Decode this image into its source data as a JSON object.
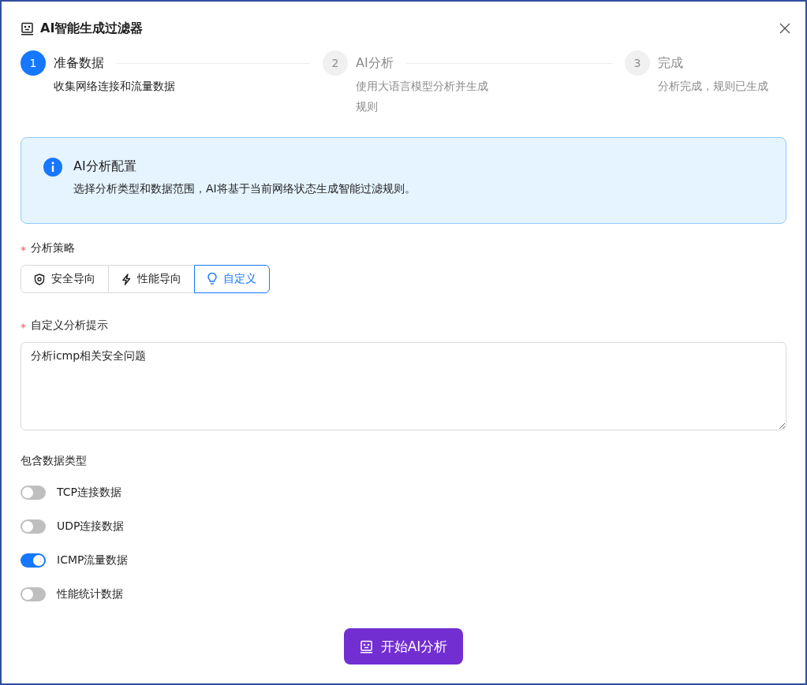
{
  "dialog": {
    "title": "AI智能生成过滤器"
  },
  "steps": [
    {
      "number": "1",
      "title": "准备数据",
      "description": "收集网络连接和流量数据",
      "active": true
    },
    {
      "number": "2",
      "title": "AI分析",
      "description": "使用大语言模型分析并生成规则",
      "active": false
    },
    {
      "number": "3",
      "title": "完成",
      "description": "分析完成，规则已生成",
      "active": false
    }
  ],
  "alert": {
    "title": "AI分析配置",
    "message": "选择分析类型和数据范围，AI将基于当前网络状态生成智能过滤规则。"
  },
  "strategy": {
    "label": "分析策略",
    "required": true,
    "options": [
      {
        "label": "安全导向",
        "kind": "shield",
        "selected": false
      },
      {
        "label": "性能导向",
        "kind": "bolt",
        "selected": false
      },
      {
        "label": "自定义",
        "kind": "bulb",
        "selected": true
      }
    ]
  },
  "prompt": {
    "label": "自定义分析提示",
    "required": true,
    "value": "分析icmp相关安全问题"
  },
  "data_types": {
    "label": "包含数据类型",
    "items": [
      {
        "label": "TCP连接数据",
        "on": false
      },
      {
        "label": "UDP连接数据",
        "on": false
      },
      {
        "label": "ICMP流量数据",
        "on": true
      },
      {
        "label": "性能统计数据",
        "on": false
      }
    ]
  },
  "start_button": {
    "label": "开始AI分析"
  }
}
